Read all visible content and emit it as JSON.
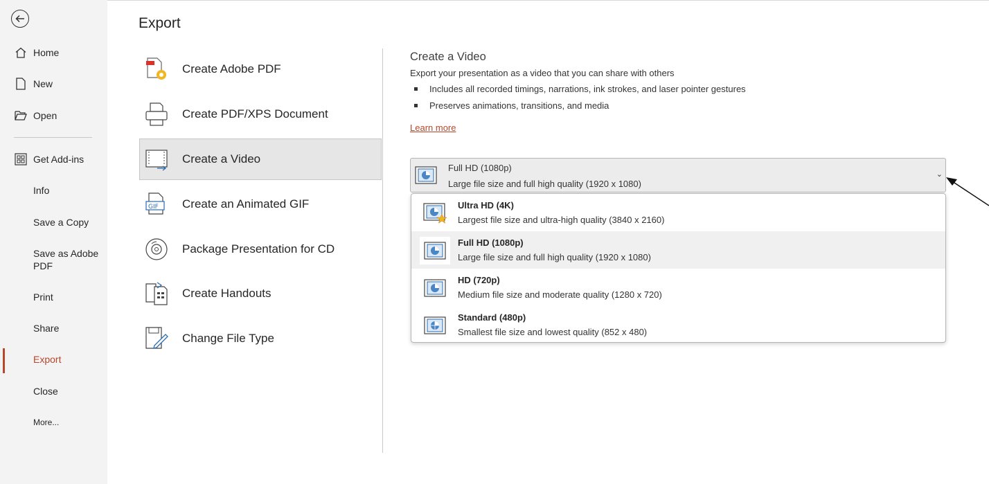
{
  "nav": {
    "items": [
      {
        "label": "Home",
        "icon": "home-icon"
      },
      {
        "label": "New",
        "icon": "new-document-icon"
      },
      {
        "label": "Open",
        "icon": "open-folder-icon"
      },
      {
        "label": "Get Add-ins",
        "icon": "add-ins-icon"
      },
      {
        "label": "Info"
      },
      {
        "label": "Save a Copy"
      },
      {
        "label": "Save as Adobe PDF"
      },
      {
        "label": "Print"
      },
      {
        "label": "Share"
      },
      {
        "label": "Export",
        "active": true
      },
      {
        "label": "Close"
      },
      {
        "label": "More..."
      }
    ]
  },
  "page": {
    "title": "Export"
  },
  "export_options": [
    {
      "label": "Create Adobe PDF",
      "icon": "adobe-pdf-icon"
    },
    {
      "label": "Create PDF/XPS Document",
      "icon": "pdf-xps-icon"
    },
    {
      "label": "Create a Video",
      "icon": "video-icon",
      "selected": true
    },
    {
      "label": "Create an Animated GIF",
      "icon": "gif-icon"
    },
    {
      "label": "Package Presentation for CD",
      "icon": "cd-icon"
    },
    {
      "label": "Create Handouts",
      "icon": "handouts-icon"
    },
    {
      "label": "Change File Type",
      "icon": "change-file-type-icon"
    }
  ],
  "detail": {
    "title": "Create a Video",
    "description": "Export your presentation as a video that you can share with others",
    "bullets": [
      "Includes all recorded timings, narrations, ink strokes, and laser pointer gestures",
      "Preserves animations, transitions, and media"
    ],
    "learn_more": "Learn more"
  },
  "quality_dropdown": {
    "selected_title": "Full HD (1080p)",
    "selected_subtitle": "Large file size and full high quality (1920 x 1080)",
    "options": [
      {
        "title": "Ultra HD (4K)",
        "subtitle": "Largest file size and ultra-high quality (3840 x 2160)"
      },
      {
        "title": "Full HD (1080p)",
        "subtitle": "Large file size and full high quality (1920 x 1080)",
        "selected": true
      },
      {
        "title": "HD (720p)",
        "subtitle": "Medium file size and moderate quality (1280 x 720)"
      },
      {
        "title": "Standard (480p)",
        "subtitle": "Smallest file size and lowest quality (852 x 480)"
      }
    ]
  },
  "colors": {
    "accent": "#b7472a",
    "nav_bg": "#f3f3f3",
    "selected_bg": "#e6e6e6"
  }
}
